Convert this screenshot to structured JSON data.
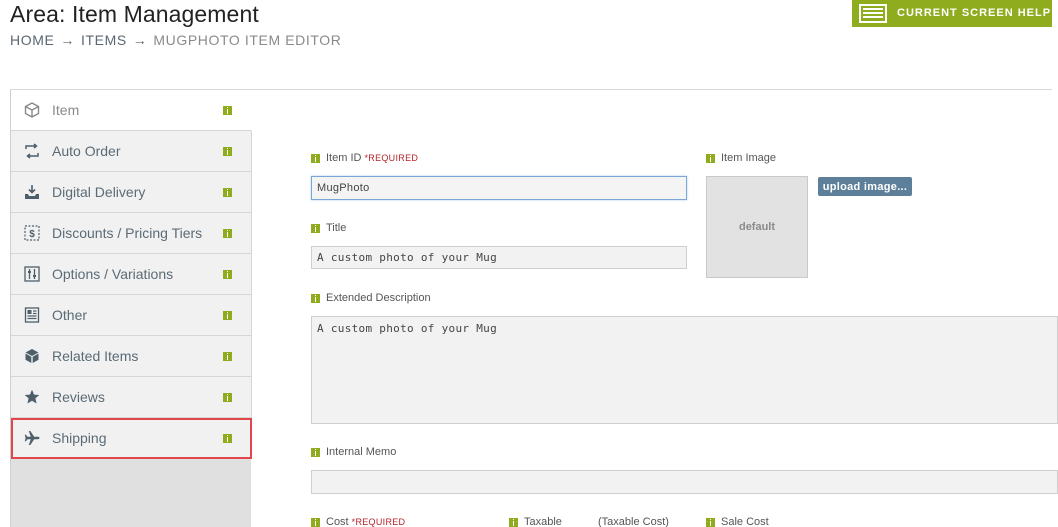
{
  "header": {
    "area_title": "Area: Item Management",
    "help_button": "CURRENT SCREEN HELP",
    "help_icon": "screen-help-icon"
  },
  "breadcrumb": {
    "items": [
      "HOME",
      "ITEMS",
      "MUGPHOTO ITEM EDITOR"
    ],
    "separator": "→"
  },
  "sidebar": {
    "active": "Item",
    "highlighted": "Shipping",
    "items": [
      {
        "label": "Item",
        "icon": "cube-icon"
      },
      {
        "label": "Auto Order",
        "icon": "repeat-icon"
      },
      {
        "label": "Digital Delivery",
        "icon": "download-tray-icon"
      },
      {
        "label": "Discounts / Pricing Tiers",
        "icon": "dollar-icon"
      },
      {
        "label": "Options / Variations",
        "icon": "sliders-icon"
      },
      {
        "label": "Other",
        "icon": "document-icon"
      },
      {
        "label": "Related Items",
        "icon": "cubes-icon"
      },
      {
        "label": "Reviews",
        "icon": "star-icon"
      },
      {
        "label": "Shipping",
        "icon": "airplane-icon"
      }
    ]
  },
  "form": {
    "item_id": {
      "label": "Item ID",
      "required": "REQUIRED",
      "value": "MugPhoto"
    },
    "title": {
      "label": "Title",
      "value": "A custom photo of your Mug"
    },
    "extended_description": {
      "label": "Extended Description",
      "value": "A custom photo of your Mug"
    },
    "internal_memo": {
      "label": "Internal Memo",
      "value": ""
    },
    "item_image": {
      "label": "Item Image",
      "placeholder": "default",
      "upload_button": "upload image..."
    },
    "cost": {
      "label": "Cost",
      "required": "REQUIRED"
    },
    "taxable": {
      "label": "Taxable"
    },
    "taxable_cost": {
      "label": "(Taxable Cost)"
    },
    "sale_cost": {
      "label": "Sale Cost"
    }
  },
  "colors": {
    "accent_green": "#8fac1e",
    "link_slate": "#5b6b76",
    "upload_button": "#5d7f99",
    "required_red": "#b4232a",
    "highlight_red": "#e0464a"
  }
}
